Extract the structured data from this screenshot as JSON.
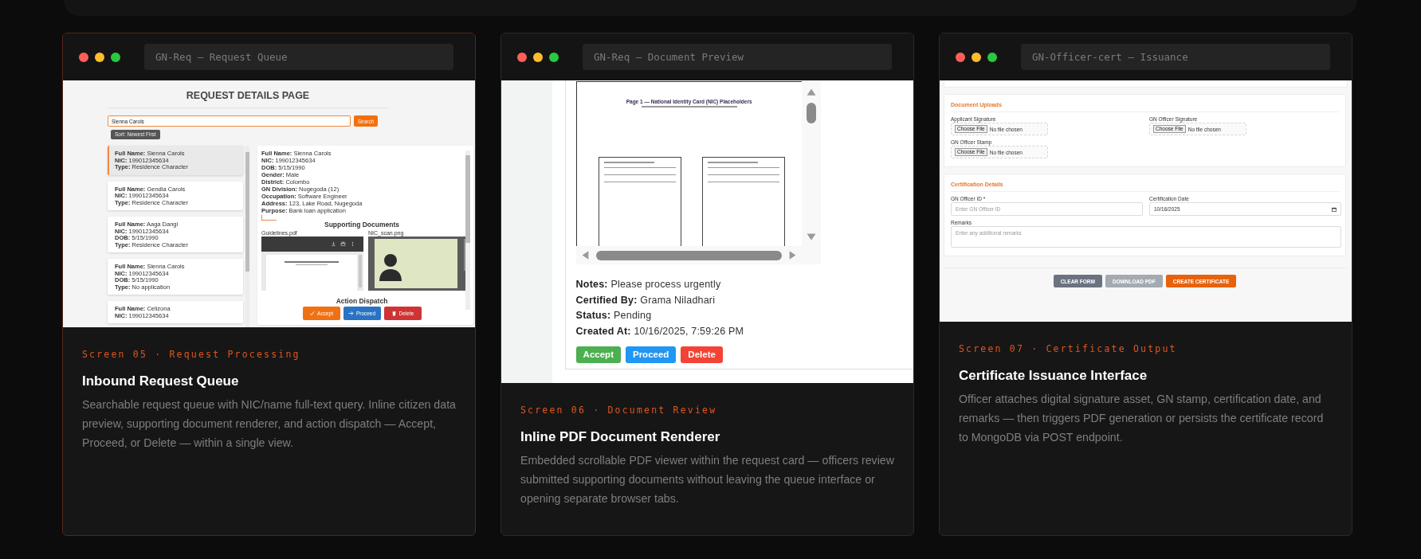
{
  "cards": [
    {
      "kind": "queue",
      "selected": true,
      "window_title": "GN-Req — Request Queue",
      "screen_label": "Screen 05 · Request Processing",
      "title": "Inbound Request Queue",
      "description": "Searchable request queue with NIC/name full-text query. Inline citizen data preview, supporting document renderer, and action dispatch — Accept, Proceed, or Delete — within a single view.",
      "screen": {
        "heading": "REQUEST DETAILS PAGE",
        "search": {
          "value": "Sienna Carols"
        },
        "search_button": "Search",
        "sort_button": "Sort: Newest First",
        "requests": [
          {
            "selected": true,
            "fields": [
              {
                "label": "Full Name:",
                "value": "Sienna Carols"
              },
              {
                "label": "NIC:",
                "value": "199012345634"
              },
              {
                "label": "Type:",
                "value": "Residence Character"
              }
            ]
          },
          {
            "selected": false,
            "fields": [
              {
                "label": "Full Name:",
                "value": "Gendia Carols"
              },
              {
                "label": "NIC:",
                "value": "199012345634"
              },
              {
                "label": "Type:",
                "value": "Residence Character"
              }
            ]
          },
          {
            "selected": false,
            "fields": [
              {
                "label": "Full Name:",
                "value": "Aaga Dangi"
              },
              {
                "label": "NIC:",
                "value": "199012345634"
              },
              {
                "label": "DOB:",
                "value": "5/15/1990"
              },
              {
                "label": "Type:",
                "value": "Residence Character"
              }
            ]
          },
          {
            "selected": false,
            "fields": [
              {
                "label": "Full Name:",
                "value": "Sienna Carols"
              },
              {
                "label": "NIC:",
                "value": "199012345634"
              },
              {
                "label": "DOB:",
                "value": "5/15/1990"
              },
              {
                "label": "Type:",
                "value": "No application"
              }
            ]
          },
          {
            "selected": false,
            "fields": [
              {
                "label": "Full Name:",
                "value": "Celizona"
              },
              {
                "label": "NIC:",
                "value": "199012345634"
              }
            ]
          }
        ],
        "details": [
          {
            "label": "Full Name:",
            "value": "Sienna Carols"
          },
          {
            "label": "NIC:",
            "value": "199012345634"
          },
          {
            "label": "DOB:",
            "value": "5/15/1990"
          },
          {
            "label": "Gender:",
            "value": "Male"
          },
          {
            "label": "District:",
            "value": "Colombo"
          },
          {
            "label": "GN Division:",
            "value": "Nugegoda (12)"
          },
          {
            "label": "Occupation:",
            "value": "Software Engineer"
          },
          {
            "label": "Address:",
            "value": "123, Lake Road, Nugegoda"
          },
          {
            "label": "Purpose:",
            "value": "Bank loan application"
          }
        ],
        "documents_heading": "Supporting Documents",
        "documents": [
          {
            "kind": "pdf",
            "name": "Guidelines.pdf"
          },
          {
            "kind": "image",
            "name": "NIC_scan.png"
          }
        ],
        "actions_heading": "Action Dispatch",
        "actions": [
          {
            "kind": "accept",
            "label": "Accept",
            "color": "#f07014"
          },
          {
            "kind": "proceed",
            "label": "Proceed",
            "color": "#2a72c4"
          },
          {
            "kind": "delete",
            "label": "Delete",
            "color": "#cf3434"
          }
        ]
      }
    },
    {
      "kind": "preview",
      "selected": false,
      "window_title": "GN-Req — Document Preview",
      "screen_label": "Screen 06 · Document Review",
      "title": "Inline PDF Document Renderer",
      "description": "Embedded scrollable PDF viewer within the request card — officers review submitted supporting documents without leaving the queue interface or opening separate browser tabs.",
      "screen": {
        "pdf": {
          "title": "Page 1 — National Identity Card (NIC) Placeholders"
        },
        "info": [
          {
            "label": "Notes:",
            "value": "Please process urgently"
          },
          {
            "label": "Certified By:",
            "value": "Grama Niladhari"
          },
          {
            "label": "Status:",
            "value": "Pending"
          },
          {
            "label": "Created At:",
            "value": "10/16/2025, 7:59:26 PM"
          }
        ],
        "actions": [
          {
            "label": "Accept",
            "color": "#4caf50"
          },
          {
            "label": "Proceed",
            "color": "#2196f3"
          },
          {
            "label": "Delete",
            "color": "#f44336"
          }
        ]
      }
    },
    {
      "kind": "issuance",
      "selected": false,
      "window_title": "GN-Officer-cert — Issuance",
      "screen_label": "Screen 07 · Certificate Output",
      "title": "Certificate Issuance Interface",
      "description": "Officer attaches digital signature asset, GN stamp, certification date, and remarks — then triggers PDF generation or persists the certificate record to MongoDB via POST endpoint.",
      "screen": {
        "sections": [
          {
            "title": "Document Uploads",
            "fields": [
              {
                "kind": "file",
                "label": "Applicant Signature",
                "button": "Choose File",
                "value": "No file chosen"
              },
              {
                "kind": "file",
                "label": "GN Officer Signature",
                "button": "Choose File",
                "value": "No file chosen"
              },
              {
                "kind": "file",
                "label": "GN Officer Stamp",
                "button": "Choose File",
                "value": "No file chosen"
              }
            ]
          },
          {
            "title": "Certification Details",
            "fields": [
              {
                "kind": "text",
                "label": "GN Officer ID *",
                "placeholder": "Enter GN Officer ID"
              },
              {
                "kind": "date",
                "label": "Certification Date",
                "value": "10/16/2025"
              },
              {
                "kind": "textarea",
                "label": "Remarks",
                "placeholder": "Enter any additional remarks"
              }
            ]
          }
        ],
        "buttons": [
          {
            "label": "CLEAR FORM",
            "color": "#6b7280"
          },
          {
            "label": "DOWNLOAD PDF",
            "color": "#a4aab2"
          },
          {
            "label": "CREATE CERTIFICATE",
            "color": "#e8620c"
          }
        ]
      }
    }
  ]
}
